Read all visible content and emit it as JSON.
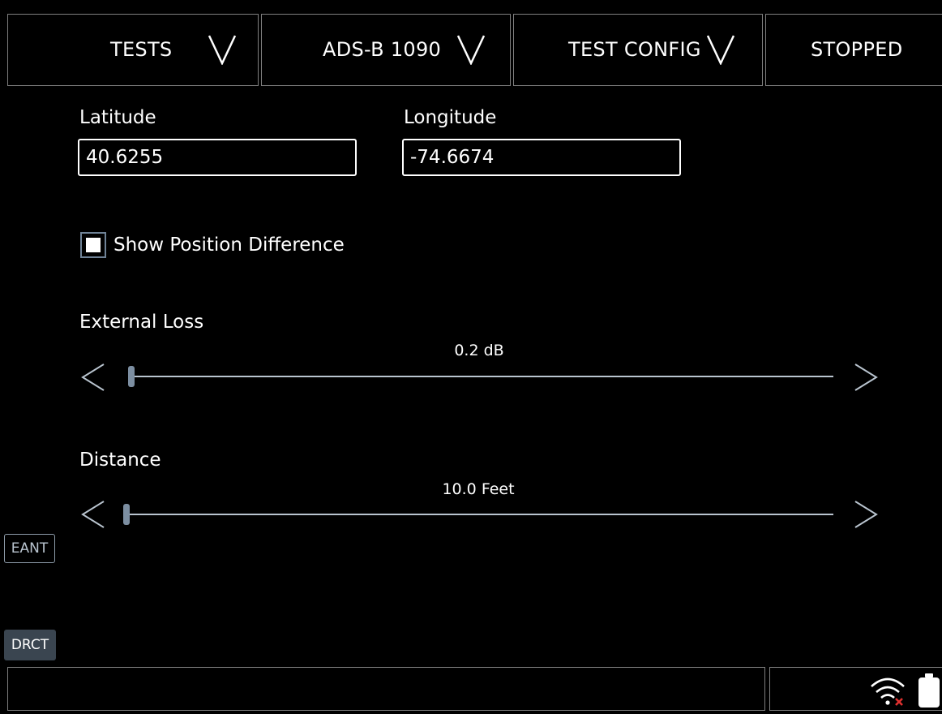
{
  "tabs": [
    {
      "label": "TESTS"
    },
    {
      "label": "ADS-B 1090"
    },
    {
      "label": "TEST CONFIG"
    },
    {
      "label": "STOPPED"
    }
  ],
  "position": {
    "latitude_label": "Latitude",
    "latitude_value": "40.6255",
    "longitude_label": "Longitude",
    "longitude_value": "-74.6674"
  },
  "show_position_difference": {
    "label": "Show Position Difference",
    "checked": true
  },
  "external_loss": {
    "label": "External Loss",
    "value_text": "0.2 dB"
  },
  "distance": {
    "label": "Distance",
    "value_text": "10.0 Feet"
  },
  "side_buttons": {
    "eant": "EANT",
    "drct": "DRCT"
  },
  "status": {
    "wifi_icon": "wifi-disconnected-icon",
    "battery_icon": "battery-icon"
  },
  "colors": {
    "background": "#000000",
    "foreground": "#ffffff",
    "accent": "#7c8ea1",
    "wifi_error": "#e0312f"
  }
}
